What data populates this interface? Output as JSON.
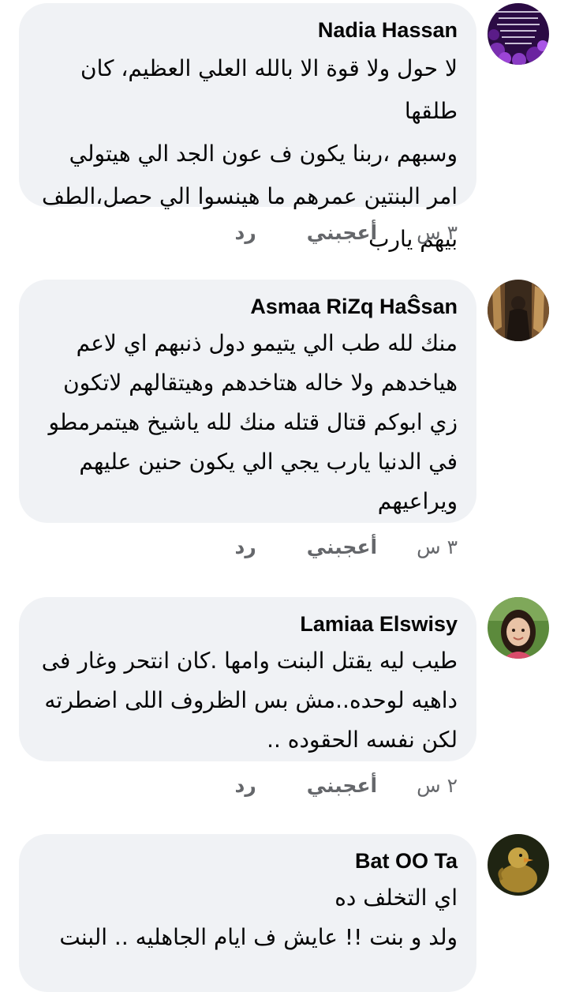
{
  "comments": [
    {
      "author": "Nadia Hassan",
      "text_lines": [
        "لا حول ولا قوة الا بالله العلي العظيم، كان طلقها",
        "وسبهم ،ربنا يكون ف عون الجد الي هيتولي",
        "امر البنتين عمرهم ما هينسوا الي حصل،الطف",
        "بيهم يارب"
      ],
      "time": "٣ س",
      "like_label": "أعجبني",
      "reply_label": "رد",
      "avatar_text": "ما الدنيا الا رحلة قصيرة بحلوها ومرها تكون فيها صابر ربنا يرضى عنك من سعيها الا العبد الاتقى"
    },
    {
      "author": "Asmaa RiZq HaŜsan",
      "text_lines": [
        "منك لله طب الي يتيمو دول ذنبهم اي لاعم",
        "هياخدهم ولا خاله هتاخدهم وهيتقالهم لاتكون",
        "زي ابوكم قتال قتله منك لله ياشيخ هيتمرمطو",
        "في الدنيا يارب يجي الي يكون حنين عليهم",
        "ويراعيهم"
      ],
      "time": "٣ س",
      "like_label": "أعجبني",
      "reply_label": "رد"
    },
    {
      "author": "Lamiaa Elswisy",
      "text_lines": [
        "طيب ليه يقتل البنت وامها .كان انتحر وغار فى",
        "داهيه لوحده..مش بس الظروف اللى اضطرته",
        "لكن نفسه الحقوده .."
      ],
      "time": "٢ س",
      "like_label": "أعجبني",
      "reply_label": "رد"
    },
    {
      "author": "Bat OO Ta",
      "text_lines": [
        "اي التخلف ده",
        "ولد و بنت !! عايش ف ايام الجاهليه .. البنت"
      ]
    }
  ],
  "colors": {
    "bubble": "#f0f2f5",
    "meta_text": "#65676b",
    "primary_text": "#050505"
  }
}
